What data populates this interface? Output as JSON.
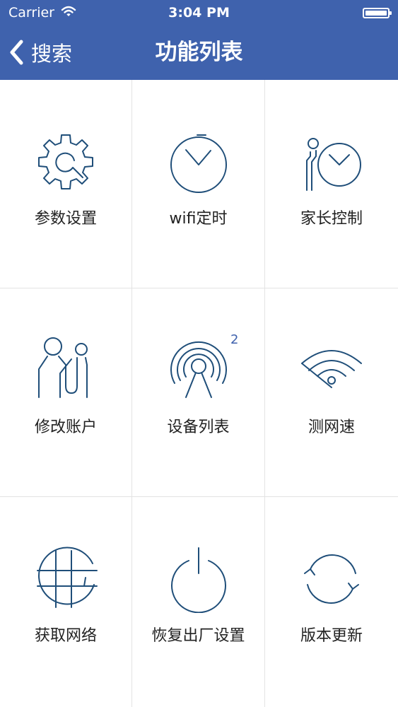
{
  "status_bar": {
    "carrier": "Carrier",
    "time": "3:04 PM"
  },
  "nav": {
    "back_label": "搜索",
    "title": "功能列表"
  },
  "grid": {
    "items": [
      {
        "label": "参数设置",
        "icon": "gear-icon"
      },
      {
        "label": "wifi定时",
        "icon": "timer-icon"
      },
      {
        "label": "家长控制",
        "icon": "parental-control-icon"
      },
      {
        "label": "修改账户",
        "icon": "users-icon"
      },
      {
        "label": "设备列表",
        "icon": "device-signal-icon",
        "badge": "2"
      },
      {
        "label": "测网速",
        "icon": "wifi-speed-icon"
      },
      {
        "label": "获取网络",
        "icon": "network-grid-icon"
      },
      {
        "label": "恢复出厂设置",
        "icon": "power-icon"
      },
      {
        "label": "版本更新",
        "icon": "refresh-icon"
      }
    ]
  },
  "colors": {
    "nav_bar": "#3f62ad",
    "icon_stroke": "#1f4e79",
    "badge": "#3f62ad"
  }
}
